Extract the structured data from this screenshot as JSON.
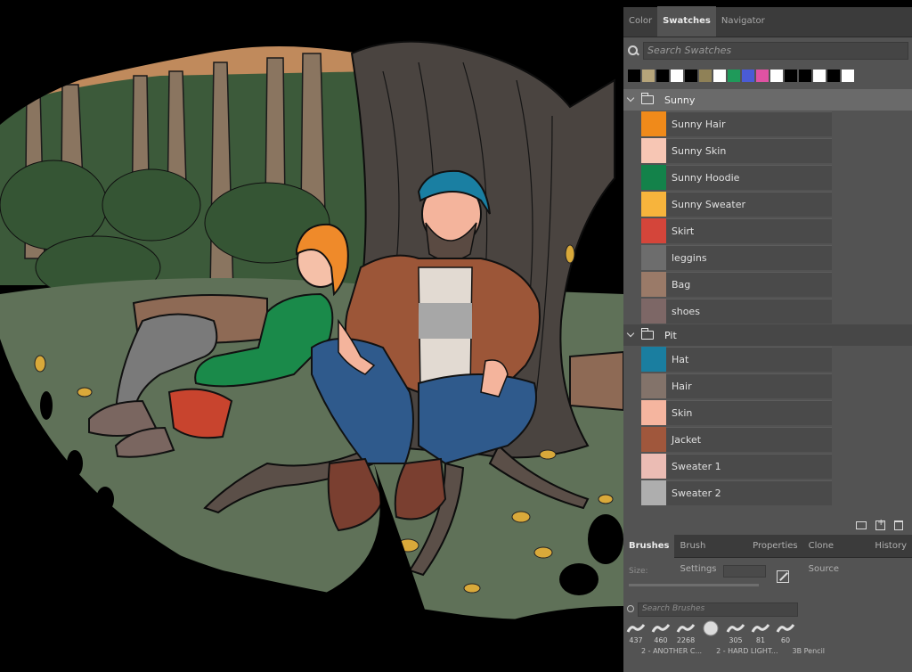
{
  "swatches_panel": {
    "tabs": [
      {
        "label": "Color",
        "active": false
      },
      {
        "label": "Swatches",
        "active": true
      },
      {
        "label": "Navigator",
        "active": false
      }
    ],
    "search_placeholder": "Search Swatches",
    "recent_colors": [
      "#000000",
      "#b6a47a",
      "#000000",
      "#ffffff",
      "#000000",
      "#8f8157",
      "#ffffff",
      "#1f9a5a",
      "#4a5bd6",
      "#e052a3",
      "#ffffff",
      "#000000",
      "#000000",
      "#ffffff",
      "#000000",
      "#ffffff"
    ],
    "groups": [
      {
        "name": "Sunny",
        "expanded": true,
        "swatches": [
          {
            "name": "Sunny Hair",
            "color": "#f08a1a"
          },
          {
            "name": "Sunny Skin",
            "color": "#f7c6b4"
          },
          {
            "name": "Sunny Hoodie",
            "color": "#13824a"
          },
          {
            "name": "Sunny Sweater",
            "color": "#f7b43c"
          },
          {
            "name": "Skirt",
            "color": "#d4453a"
          },
          {
            "name": "leggins",
            "color": "#6d6d6d"
          },
          {
            "name": "Bag",
            "color": "#9a7a68"
          },
          {
            "name": "shoes",
            "color": "#7d6766"
          }
        ]
      },
      {
        "name": "Pit",
        "expanded": true,
        "swatches": [
          {
            "name": "Hat",
            "color": "#1a7ea0"
          },
          {
            "name": "Hair",
            "color": "#83736a"
          },
          {
            "name": "Skin",
            "color": "#f5b59f"
          },
          {
            "name": "Jacket",
            "color": "#a0573c"
          },
          {
            "name": "Sweater 1",
            "color": "#ebbcb4"
          },
          {
            "name": "Sweater 2",
            "color": "#aeaeae"
          }
        ]
      }
    ],
    "footer_icons": [
      "new-group-icon",
      "new-swatch-icon",
      "trash-icon"
    ]
  },
  "brushes_panel": {
    "tabs": [
      {
        "label": "Brushes",
        "active": true
      },
      {
        "label": "Brush Settings",
        "active": false
      },
      {
        "label": "Properties",
        "active": false
      },
      {
        "label": "Clone Source",
        "active": false
      },
      {
        "label": "History",
        "active": false
      }
    ],
    "size_label": "Size:",
    "search_placeholder": "Search Brushes",
    "brushes": [
      {
        "size": "437"
      },
      {
        "size": "460"
      },
      {
        "size": "2268"
      },
      {
        "size": ""
      },
      {
        "size": "305"
      },
      {
        "size": "81"
      },
      {
        "size": "60"
      }
    ],
    "brush_name_row": [
      "2 - ANOTHER C...",
      "2 - HARD LIGHT...",
      "3B Pencil"
    ]
  }
}
